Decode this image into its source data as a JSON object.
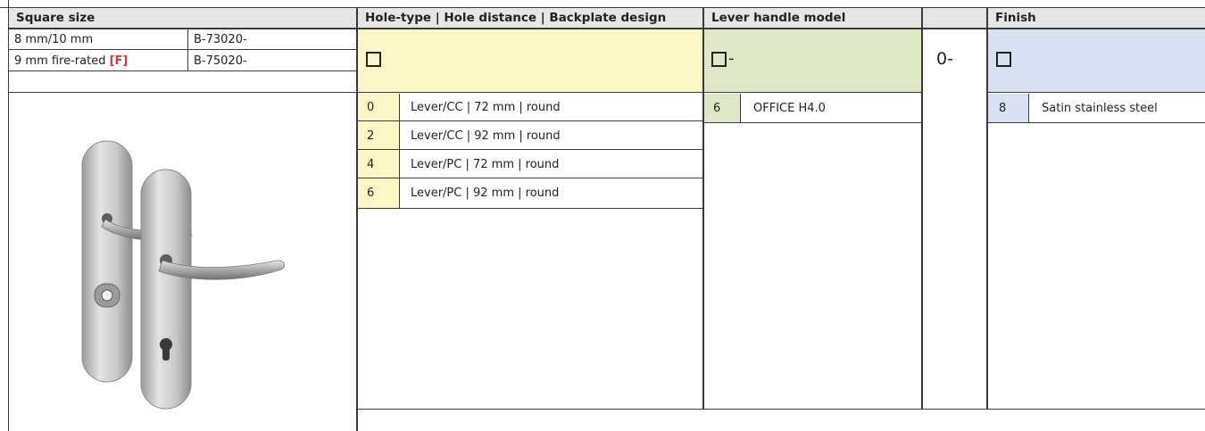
{
  "headers": {
    "square_size": "Square size",
    "hole_type": "Hole-type | Hole distance | Backplate design",
    "lever_model": "Lever handle model",
    "finish": "Finish"
  },
  "square_rows": [
    {
      "size": "8 mm/10 mm",
      "size_suffix": "",
      "code": "B-73020-"
    },
    {
      "size": "9 mm fire-rated ",
      "size_suffix": "[F]",
      "code": "B-75020-"
    }
  ],
  "code_boxes": {
    "lever_suffix": "-",
    "middle": "0-"
  },
  "hole_type_options": [
    {
      "code": "0",
      "label": "Lever/CC | 72 mm | round"
    },
    {
      "code": "2",
      "label": "Lever/CC | 92 mm | round"
    },
    {
      "code": "4",
      "label": "Lever/PC | 72 mm | round"
    },
    {
      "code": "6",
      "label": "Lever/PC | 92 mm | round"
    }
  ],
  "lever_options": [
    {
      "code": "6",
      "label": "OFFICE H4.0"
    }
  ],
  "finish_options": [
    {
      "code": "8",
      "label": "Satin stainless steel"
    }
  ],
  "colors": {
    "header_bg": "#e6e6e6",
    "hole_type_bg": "#fdf7c6",
    "lever_bg": "#dde8c7",
    "finish_bg": "#d7e1f1",
    "fire_rated": "#e3342f"
  }
}
